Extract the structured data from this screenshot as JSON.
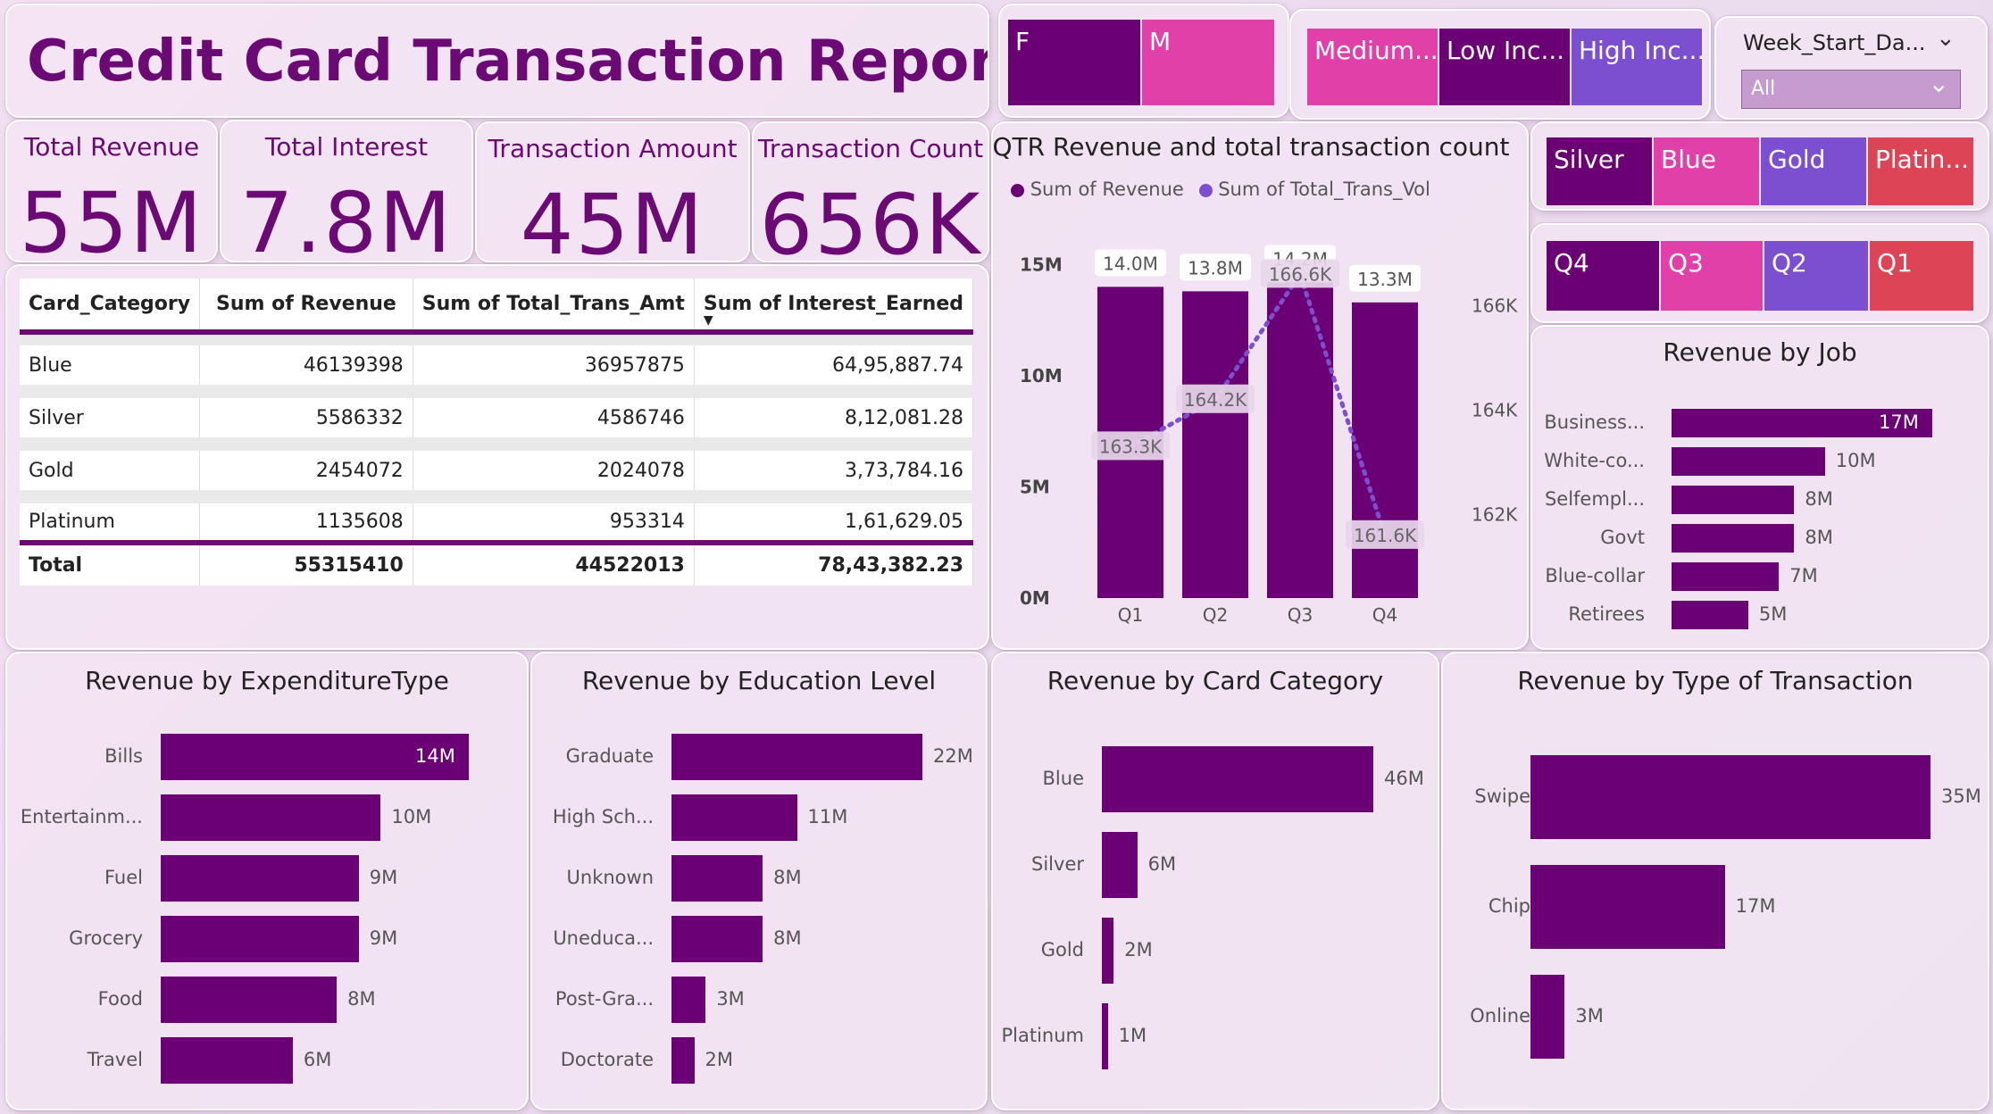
{
  "report": {
    "title": "Credit Card Transaction Report"
  },
  "kpis": [
    {
      "label": "Total Revenue",
      "value": "55M"
    },
    {
      "label": "Total Interest",
      "value": "7.8M"
    },
    {
      "label": "Transaction Amount",
      "value": "45M"
    },
    {
      "label": "Transaction Count",
      "value": "656K"
    }
  ],
  "gender_slicer": {
    "items": [
      {
        "label": "F",
        "color": "#6b0074"
      },
      {
        "label": "M",
        "color": "#e040a8"
      }
    ]
  },
  "income_slicer": {
    "items": [
      {
        "label": "Medium...",
        "color": "#e040a8"
      },
      {
        "label": "Low Inc...",
        "color": "#6b0074"
      },
      {
        "label": "High Inc...",
        "color": "#7b4fcf"
      }
    ]
  },
  "week_filter": {
    "label": "Week_Start_Da...",
    "value": "All"
  },
  "card_slicer": {
    "items": [
      {
        "label": "Silver",
        "color": "#6b0074"
      },
      {
        "label": "Blue",
        "color": "#e040a8"
      },
      {
        "label": "Gold",
        "color": "#7b4fcf"
      },
      {
        "label": "Platin...",
        "color": "#dd4456"
      }
    ]
  },
  "qtr_slicer": {
    "items": [
      {
        "label": "Q4",
        "color": "#6b0074"
      },
      {
        "label": "Q3",
        "color": "#e040a8"
      },
      {
        "label": "Q2",
        "color": "#7b4fcf"
      },
      {
        "label": "Q1",
        "color": "#dd4456"
      }
    ]
  },
  "matrix": {
    "headers": [
      "Card_Category",
      "Sum of Revenue",
      "Sum of Total_Trans_Amt",
      "Sum of Interest_Earned"
    ],
    "rows": [
      [
        "Blue",
        "46139398",
        "36957875",
        "64,95,887.74"
      ],
      [
        "Silver",
        "5586332",
        "4586746",
        "8,12,081.28"
      ],
      [
        "Gold",
        "2454072",
        "2024078",
        "3,73,784.16"
      ],
      [
        "Platinum",
        "1135608",
        "953314",
        "1,61,629.05"
      ]
    ],
    "total": [
      "Total",
      "55315410",
      "44522013",
      "78,43,382.23"
    ]
  },
  "chart_data": [
    {
      "type": "bar",
      "title": "QTR Revenue and total transaction count",
      "categories": [
        "Q1",
        "Q2",
        "Q3",
        "Q4"
      ],
      "series": [
        {
          "name": "Sum of Revenue",
          "values": [
            14.0,
            13.8,
            14.2,
            13.3
          ],
          "labels": [
            "14.0M",
            "13.8M",
            "14.2M",
            "13.3M"
          ],
          "color": "#6b0074"
        },
        {
          "name": "Sum of Total_Trans_Vol",
          "values": [
            163.3,
            164.2,
            166.6,
            161.6
          ],
          "labels": [
            "163.3K",
            "164.2K",
            "166.6K",
            "161.6K"
          ],
          "color": "#7b4fcf",
          "style": "dotted-line"
        }
      ],
      "y_ticks": [
        "0M",
        "5M",
        "10M",
        "15M"
      ],
      "y2_ticks": [
        "162K",
        "164K",
        "166K"
      ],
      "ylim": [
        0,
        15.5
      ],
      "y2lim": [
        160.4,
        167.0
      ]
    },
    {
      "type": "bar",
      "orientation": "horizontal",
      "title": "Revenue by Job",
      "categories": [
        "Business...",
        "White-co...",
        "Selfempl...",
        "Govt",
        "Blue-collar",
        "Retirees"
      ],
      "values": [
        17,
        10,
        8,
        8,
        7,
        5
      ],
      "labels": [
        "17M",
        "10M",
        "8M",
        "8M",
        "7M",
        "5M"
      ]
    },
    {
      "type": "bar",
      "orientation": "horizontal",
      "title": "Revenue by ExpenditureType",
      "categories": [
        "Bills",
        "Entertainm...",
        "Fuel",
        "Grocery",
        "Food",
        "Travel"
      ],
      "values": [
        14,
        10,
        9,
        9,
        8,
        6
      ],
      "labels": [
        "14M",
        "10M",
        "9M",
        "9M",
        "8M",
        "6M"
      ]
    },
    {
      "type": "bar",
      "orientation": "horizontal",
      "title": "Revenue by Education Level",
      "categories": [
        "Graduate",
        "High Sch...",
        "Unknown",
        "Uneduca...",
        "Post-Gra...",
        "Doctorate"
      ],
      "values": [
        22,
        11,
        8,
        8,
        3,
        2
      ],
      "labels": [
        "22M",
        "11M",
        "8M",
        "8M",
        "3M",
        "2M"
      ]
    },
    {
      "type": "bar",
      "orientation": "horizontal",
      "title": "Revenue by Card Category",
      "categories": [
        "Blue",
        "Silver",
        "Gold",
        "Platinum"
      ],
      "values": [
        46,
        6,
        2,
        1
      ],
      "labels": [
        "46M",
        "6M",
        "2M",
        "1M"
      ]
    },
    {
      "type": "bar",
      "orientation": "horizontal",
      "title": "Revenue by Type of Transaction",
      "categories": [
        "Swipe",
        "Chip",
        "Online"
      ],
      "values": [
        35,
        17,
        3
      ],
      "labels": [
        "35M",
        "17M",
        "3M"
      ]
    }
  ]
}
